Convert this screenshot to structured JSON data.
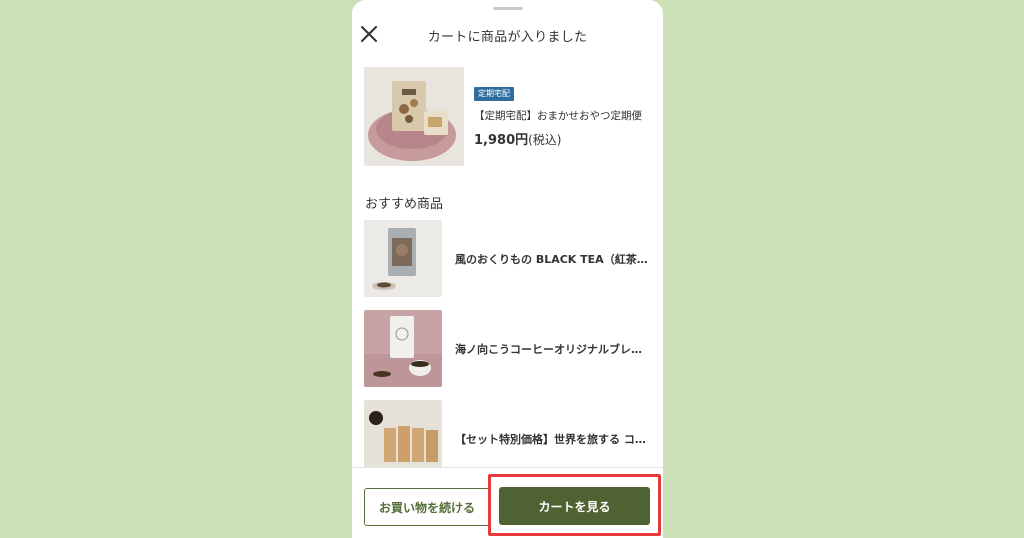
{
  "header": {
    "title": "カートに商品が入りました",
    "close_icon": "close-icon"
  },
  "added_item": {
    "badge": "定期宅配",
    "name": "【定期宅配】おまかせおやつ定期便",
    "price": "1,980円",
    "tax_note": "(税込)"
  },
  "recommendations": {
    "title": "おすすめ商品",
    "items": [
      {
        "name": "風のおくりもの BLACK TEA（紅茶…"
      },
      {
        "name": "海ノ向こうコーヒーオリジナルブレンド"
      },
      {
        "name": "【セット特別価格】世界を旅する コー…"
      }
    ]
  },
  "footer": {
    "continue_label": "お買い物を続ける",
    "view_cart_label": "カートを見る"
  },
  "colors": {
    "background": "#cce1b8",
    "accent_green": "#4e6233",
    "badge_blue": "#2f6e9f",
    "highlight_red": "#e63b3b"
  }
}
